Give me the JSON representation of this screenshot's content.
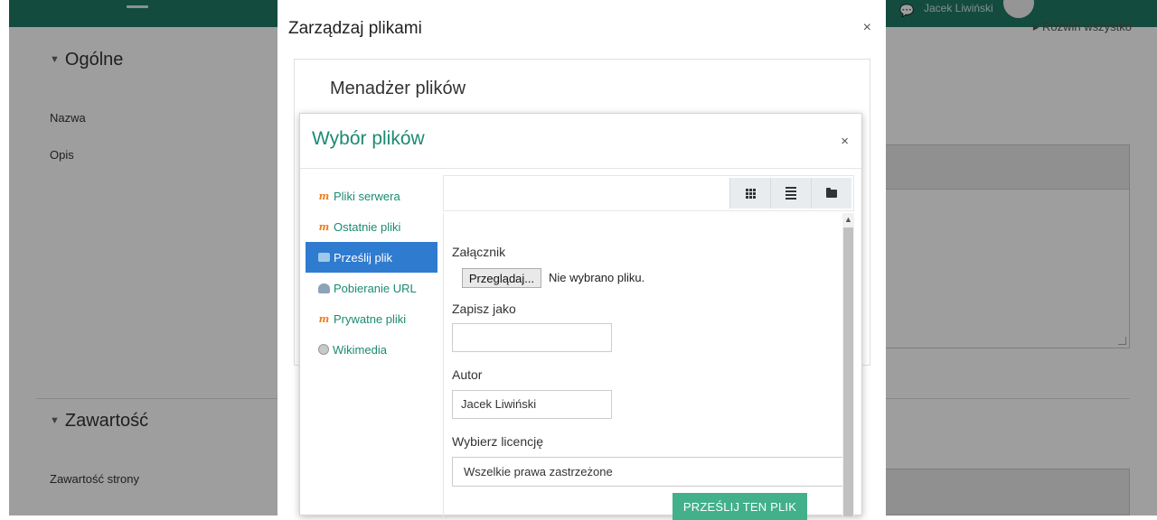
{
  "background": {
    "user_name": "Jacek Liwiński",
    "expand_all": "Rozwiń wszystko",
    "section_general": "Ogólne",
    "label_name": "Nazwa",
    "label_description": "Opis",
    "section_content": "Zawartość",
    "label_page_content": "Zawartość strony"
  },
  "outer_dialog": {
    "title": "Zarządzaj plikami",
    "close": "×",
    "heading": "Menadżer plików"
  },
  "file_picker": {
    "title": "Wybór plików",
    "close": "×",
    "repositories": [
      {
        "label": "Pliki serwera",
        "icon": "moodle-icon"
      },
      {
        "label": "Ostatnie pliki",
        "icon": "moodle-icon"
      },
      {
        "label": "Prześlij plik",
        "icon": "upload-icon",
        "active": true
      },
      {
        "label": "Pobieranie URL",
        "icon": "url-download-icon"
      },
      {
        "label": "Prywatne pliki",
        "icon": "moodle-icon"
      },
      {
        "label": "Wikimedia",
        "icon": "wikimedia-icon"
      }
    ],
    "view_buttons": [
      "grid-view-icon",
      "list-view-icon",
      "folder-view-icon"
    ],
    "form": {
      "attachment_label": "Załącznik",
      "browse_button": "Przeglądaj...",
      "no_file": "Nie wybrano pliku.",
      "save_as_label": "Zapisz jako",
      "save_as_value": "",
      "author_label": "Autor",
      "author_value": "Jacek Liwiński",
      "license_label": "Wybierz licencję",
      "license_value": "Wszelkie prawa zastrzeżone",
      "upload_button": "PRZEŚLIJ TEN PLIK"
    }
  },
  "colors": {
    "accent": "#1b8b72",
    "active_item": "#2f7bd0",
    "upload_button": "#42b08a",
    "topbar": "#1f7a66"
  }
}
